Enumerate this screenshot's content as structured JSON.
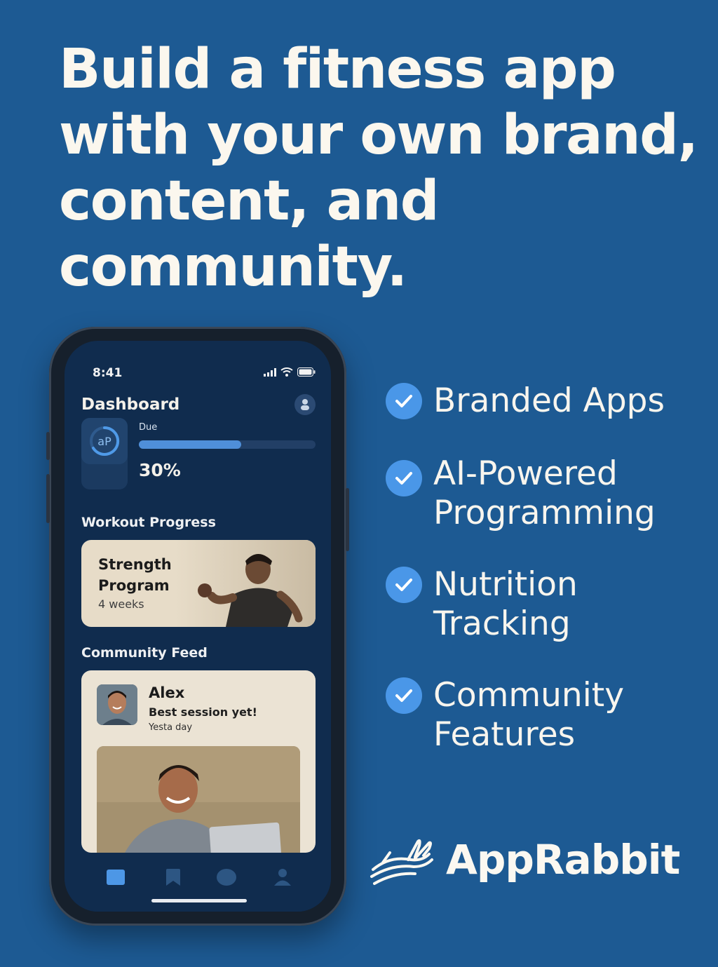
{
  "headline": {
    "lines": [
      "Build a fitness app",
      "with your own brand,",
      "content, and",
      "community."
    ]
  },
  "phone": {
    "status_time": "8:41",
    "dashboard_title": "Dashboard",
    "progress": {
      "ring_label": "aP",
      "due_label": "Due",
      "percent_text": "30%",
      "fraction": 0.58
    },
    "workout_section_title": "Workout Progress",
    "workout_card": {
      "title_line1": "Strength",
      "title_line2": "Program",
      "subtitle": "4 weeks"
    },
    "community_section_title": "Community Feed",
    "feed_post": {
      "name": "Alex",
      "message": "Best session yet!",
      "time": "Yesta day"
    },
    "tabs": [
      "home-icon",
      "bookmark-icon",
      "chat-icon",
      "profile-icon"
    ]
  },
  "features": [
    {
      "lines": [
        "Branded Apps"
      ]
    },
    {
      "lines": [
        "AI-Powered",
        "Programming"
      ]
    },
    {
      "lines": [
        "Nutrition",
        "Tracking"
      ]
    },
    {
      "lines": [
        "Community",
        "Features"
      ]
    }
  ],
  "brand": {
    "name": "AppRabbit",
    "logo_icon": "rabbit-logo-icon"
  },
  "colors": {
    "background": "#1d5a93",
    "accent": "#4a97e8",
    "card": "#e7dcc8"
  }
}
